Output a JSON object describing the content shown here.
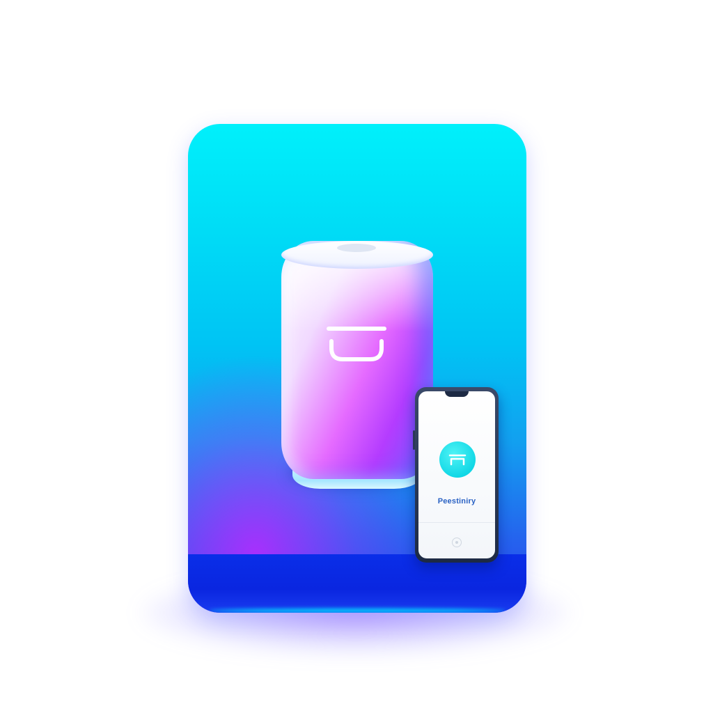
{
  "scene": {
    "colors": {
      "card_top": "#00f0fb",
      "card_bottom": "#2b3ff0",
      "card_base": "#0a26e0",
      "accent_magenta": "#e56bff",
      "app_icon": "#12d8e6",
      "phone_frame": "#1d2a44",
      "label_text": "#2a62c4"
    },
    "speaker": {
      "logo_icon": "bowl-logo-icon"
    },
    "phone": {
      "app_icon": "app-logo-icon",
      "app_label": "Peestiniry",
      "home_icon": "home-button-icon"
    }
  }
}
